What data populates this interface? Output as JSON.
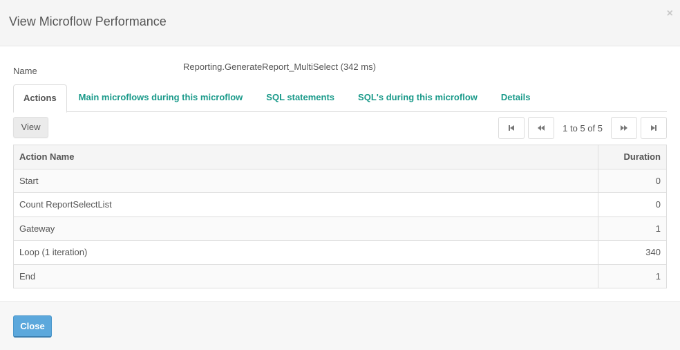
{
  "dialog": {
    "title": "View Microflow Performance",
    "close_icon": "×"
  },
  "details": {
    "name_label": "Name",
    "name_value": "Reporting.GenerateReport_MultiSelect (342 ms)"
  },
  "tabs": [
    {
      "label": "Actions",
      "active": true
    },
    {
      "label": "Main microflows during this microflow",
      "active": false
    },
    {
      "label": "SQL statements",
      "active": false
    },
    {
      "label": "SQL's during this microflow",
      "active": false
    },
    {
      "label": "Details",
      "active": false
    }
  ],
  "toolbar": {
    "view_label": "View"
  },
  "pager": {
    "first_icon": "first-page-icon",
    "prev_icon": "previous-page-icon",
    "status": "1 to 5 of 5",
    "next_icon": "next-page-icon",
    "last_icon": "last-page-icon"
  },
  "table": {
    "columns": [
      "Action Name",
      "Duration"
    ],
    "rows": [
      {
        "action": "Start",
        "duration": "0"
      },
      {
        "action": "Count ReportSelectList",
        "duration": "0"
      },
      {
        "action": "Gateway",
        "duration": "1"
      },
      {
        "action": "Loop (1 iteration)",
        "duration": "340"
      },
      {
        "action": "End",
        "duration": "1"
      }
    ]
  },
  "footer": {
    "close_label": "Close"
  },
  "colors": {
    "tab_link": "#1a9a8a",
    "primary_button": "#5ca8dc"
  }
}
